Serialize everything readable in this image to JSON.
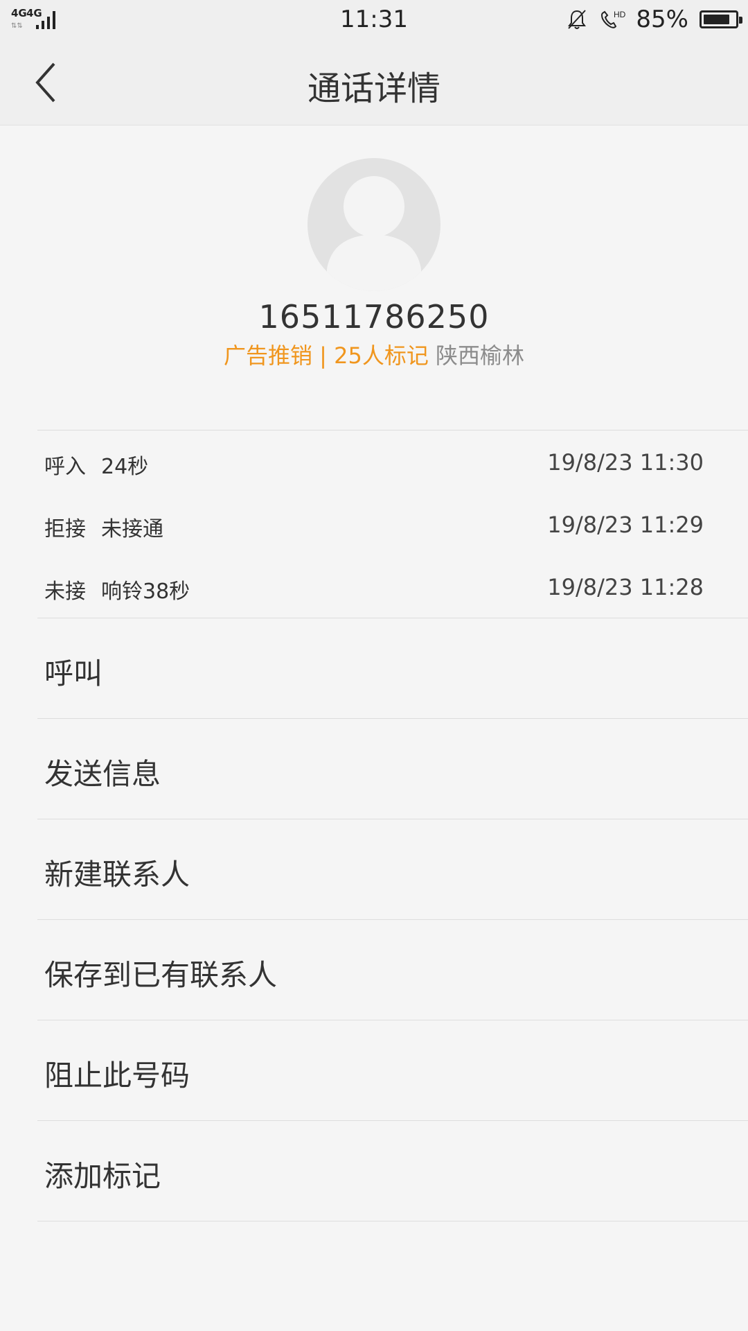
{
  "status_bar": {
    "network_1": "4G",
    "network_2": "4G",
    "time": "11:31",
    "battery_text": "85%",
    "battery_level": 0.85,
    "icons": [
      "signal-icon",
      "mute-bell-icon",
      "hd-call-icon",
      "battery-icon"
    ]
  },
  "header": {
    "title": "通话详情",
    "back_icon": "chevron-left-icon"
  },
  "contact": {
    "avatar_icon": "default-avatar-icon",
    "number": "16511786250",
    "tag": "广告推销 | 25人标记",
    "location": "陕西榆林"
  },
  "call_log": [
    {
      "type": "呼入",
      "detail": "24秒",
      "time": "19/8/23 11:30"
    },
    {
      "type": "拒接",
      "detail": "未接通",
      "time": "19/8/23 11:29"
    },
    {
      "type": "未接",
      "detail": "响铃38秒",
      "time": "19/8/23 11:28"
    }
  ],
  "actions": [
    {
      "label": "呼叫"
    },
    {
      "label": "发送信息"
    },
    {
      "label": "新建联系人"
    },
    {
      "label": "保存到已有联系人"
    },
    {
      "label": "阻止此号码"
    },
    {
      "label": "添加标记"
    }
  ],
  "colors": {
    "tag_orange": "#f0961e",
    "location_gray": "#8c8c8c",
    "background": "#f5f5f5"
  }
}
